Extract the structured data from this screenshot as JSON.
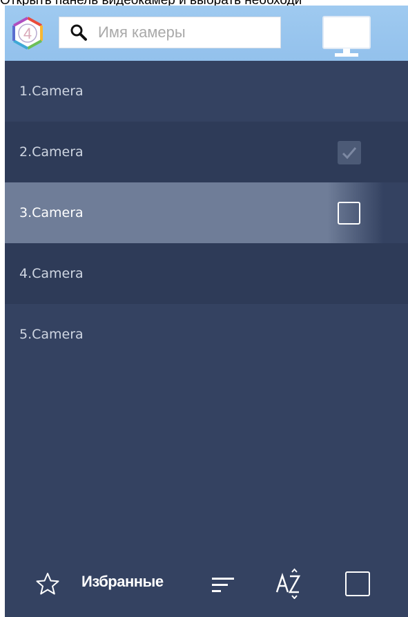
{
  "caption": "Открыть панель видеокамер и выбрать необходи",
  "search": {
    "placeholder": "Имя камеры",
    "value": ""
  },
  "logo": {
    "text": "4"
  },
  "cameras": [
    {
      "label": "1.Camera",
      "checkbox": "none"
    },
    {
      "label": "2.Camera",
      "checkbox": "checked"
    },
    {
      "label": "3.Camera",
      "checkbox": "unchecked",
      "selected": true
    },
    {
      "label": "4.Camera",
      "checkbox": "none"
    },
    {
      "label": "5.Camera",
      "checkbox": "none"
    }
  ],
  "footer": {
    "favorites_label": "Избранные",
    "icons": [
      "star-icon",
      "sort-icon",
      "sort-az-icon",
      "select-all-checkbox"
    ]
  },
  "colors": {
    "panel": "#344261",
    "row_alt": "#2e3b58",
    "row_selected": "#6f7d98",
    "topbar": "#9fcaf0"
  }
}
